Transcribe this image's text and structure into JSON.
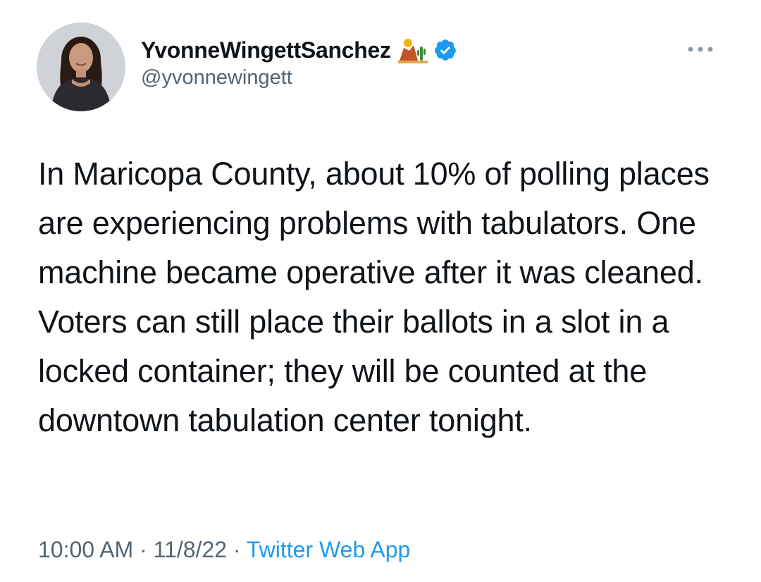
{
  "author": {
    "display_name": "YvonneWingettSanchez",
    "handle": "@yvonnewingett",
    "name_emoji": "desert-cactus-emoji",
    "verified_icon": "verified-badge-icon"
  },
  "tweet": {
    "text": "In Maricopa County, about 10% of polling places are experiencing problems with tabulators. One machine became operative after it was cleaned. Voters can still place their ballots in a slot in a locked container; they will be counted at the downtown tabulation center tonight.",
    "time": "10:00 AM",
    "separator": "·",
    "date": "11/8/22",
    "source": "Twitter Web App"
  },
  "more_icon": "more-options-icon",
  "colors": {
    "text": "#0f1419",
    "secondary": "#536471",
    "link": "#1d9bf0",
    "verified": "#1d9bf0"
  }
}
